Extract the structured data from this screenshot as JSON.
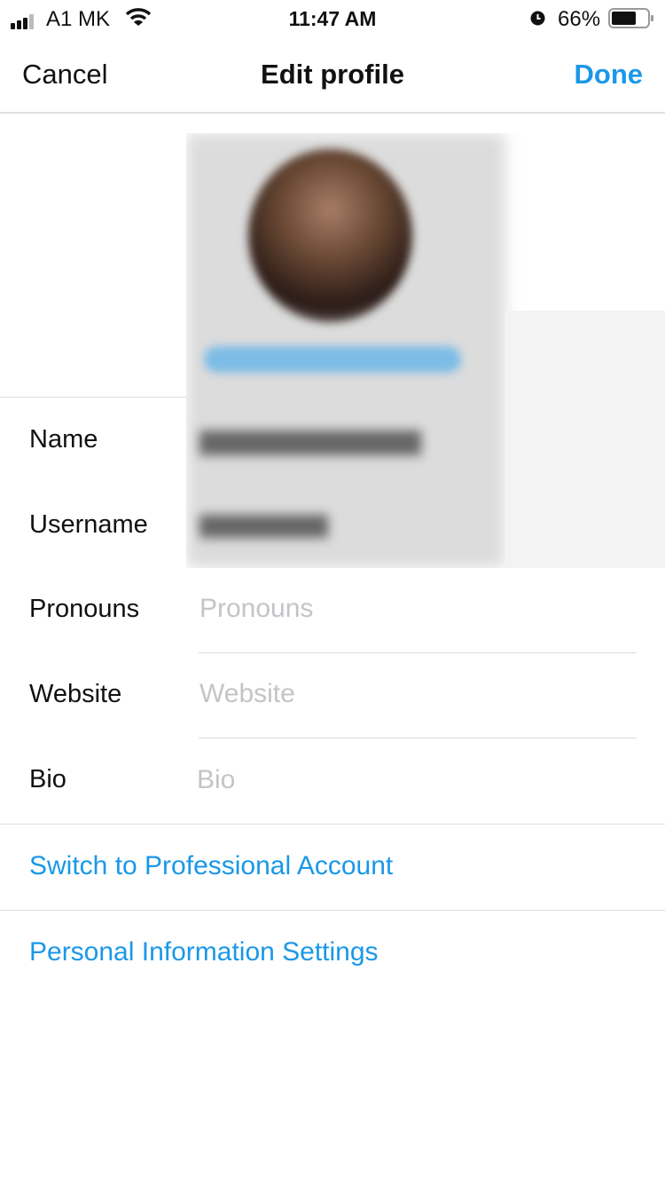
{
  "status_bar": {
    "carrier": "A1 MK",
    "time": "11:47 AM",
    "battery": "66%",
    "battery_level": 0.66,
    "icons": [
      "signal-icon",
      "wifi-icon",
      "alarm-icon",
      "battery-icon"
    ]
  },
  "nav": {
    "cancel": "Cancel",
    "title": "Edit profile",
    "done": "Done"
  },
  "fields": [
    {
      "label": "Name",
      "placeholder": "",
      "value": ""
    },
    {
      "label": "Username",
      "placeholder": "",
      "value": ""
    },
    {
      "label": "Pronouns",
      "placeholder": "Pronouns",
      "value": ""
    },
    {
      "label": "Website",
      "placeholder": "Website",
      "value": ""
    },
    {
      "label": "Bio",
      "placeholder": "Bio",
      "value": ""
    }
  ],
  "links": {
    "professional": "Switch to Professional Account",
    "personal": "Personal Information Settings"
  },
  "colors": {
    "accent": "#1a98e8",
    "placeholder": "#c4c4c8"
  }
}
